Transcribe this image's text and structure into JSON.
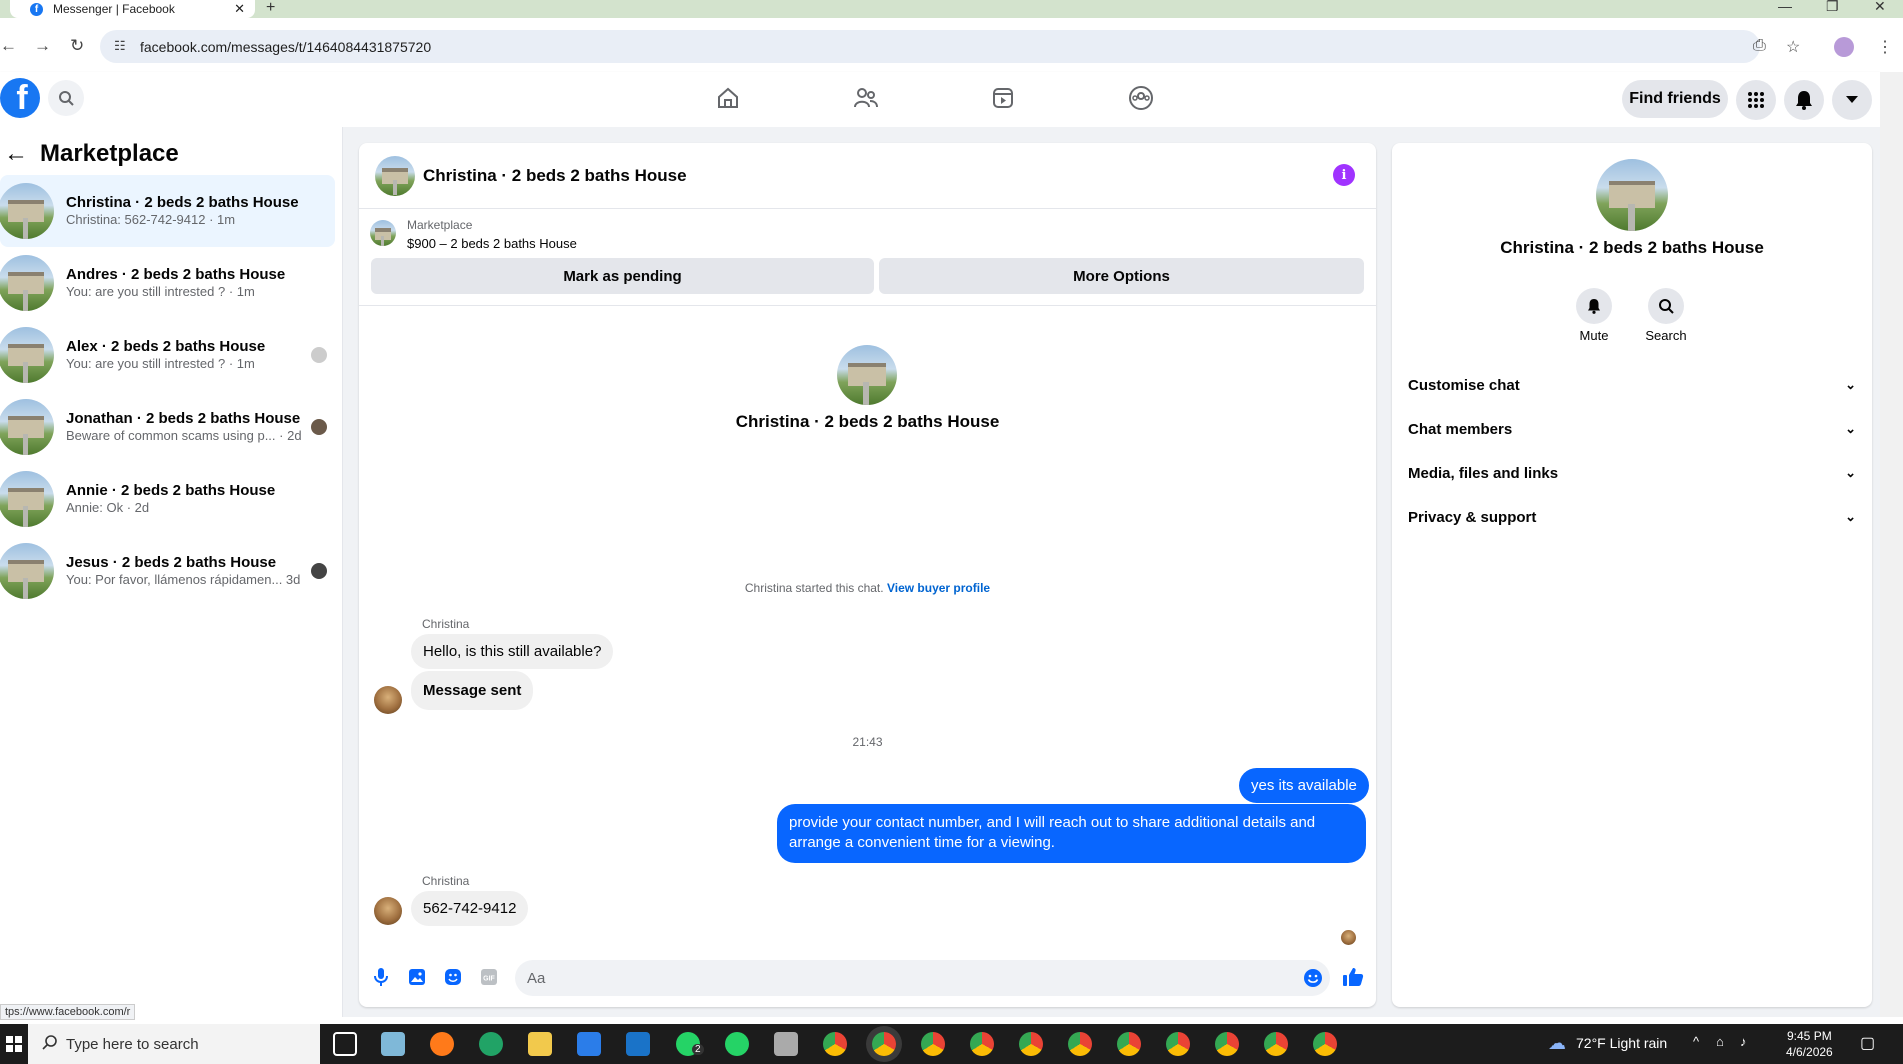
{
  "browser": {
    "tab_title": "Messenger | Facebook",
    "tab_favicon": "facebook-icon",
    "new_tab": "+",
    "url": "facebook.com/messages/t/1464084431875720"
  },
  "header": {
    "logo": "f",
    "find_friends": "Find friends",
    "nav": [
      "home-icon",
      "friends-icon",
      "video-icon",
      "groups-icon"
    ]
  },
  "sidebar": {
    "title": "Marketplace",
    "conversations": [
      {
        "name": "Christina · 2 beds 2 baths House",
        "preview": "Christina: 562-742-9412 · 1m",
        "active": true
      },
      {
        "name": "Andres · 2 beds 2 baths House",
        "preview": "You: are you still intrested ? · 1m"
      },
      {
        "name": "Alex · 2 beds 2 baths House",
        "preview": "You: are you still intrested ? · 1m"
      },
      {
        "name": "Jonathan · 2 beds 2 baths House",
        "preview": "Beware of common scams using p...  · 2d"
      },
      {
        "name": "Annie · 2 beds 2 baths House",
        "preview": "Annie: Ok · 2d"
      },
      {
        "name": "Jesus · 2 beds 2 baths House",
        "preview": "You: Por favor, llámenos rápidamen...  3d"
      }
    ]
  },
  "chat": {
    "title": "Christina · 2 beds 2 baths House",
    "listing_source": "Marketplace",
    "listing_title": "$900 – 2 beds 2 baths House",
    "mark_pending": "Mark as pending",
    "more_options": "More Options",
    "intro_name": "Christina · 2 beds 2 baths House",
    "started_text": "Christina started this chat.",
    "view_profile": "View buyer profile",
    "sender1": "Christina",
    "msg1": "Hello, is this still available?",
    "msg2": "Message sent",
    "timestamp": "21:43",
    "out1": "yes its available",
    "out2": "provide your contact number, and I will reach out to share additional details and arrange a convenient time for a viewing.",
    "sender2": "Christina",
    "msg3": "562-742-9412",
    "input_placeholder": "Aa"
  },
  "details": {
    "name": "Christina · 2 beds 2 baths House",
    "mute": "Mute",
    "search": "Search",
    "sections": [
      "Customise chat",
      "Chat members",
      "Media, files and links",
      "Privacy & support"
    ]
  },
  "status_url": "tps://www.facebook.com/r",
  "taskbar": {
    "search_placeholder": "Type here to search",
    "weather": "72°F  Light rain",
    "time": "9:45 PM",
    "date": "4/6/2026",
    "whatsapp_badge": "2"
  },
  "colors": {
    "brand": "#1877f2",
    "outgoing_bubble": "#0866ff",
    "info": "#a033ff"
  }
}
